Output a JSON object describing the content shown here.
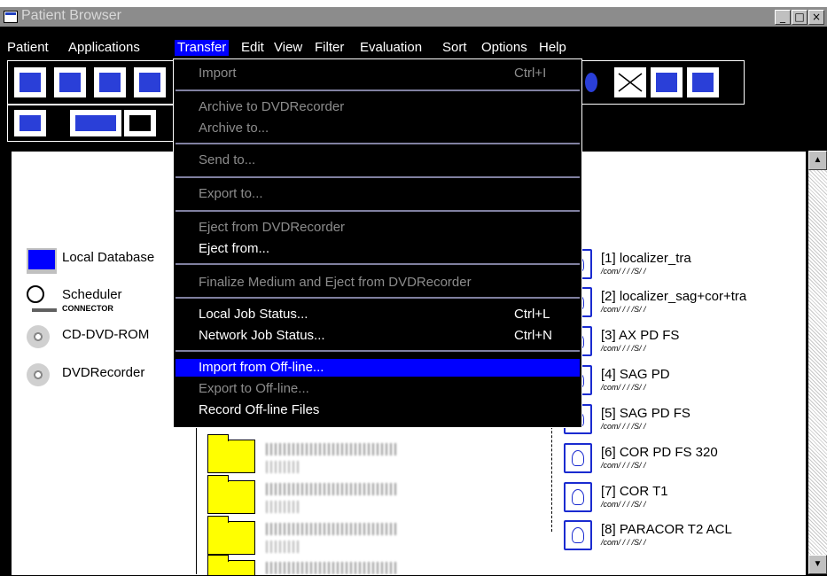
{
  "window": {
    "title": "Patient Browser",
    "controls": [
      "_",
      "□",
      "×"
    ]
  },
  "menubar": {
    "items": [
      {
        "label": "Patient",
        "key": "P"
      },
      {
        "label": "Applications",
        "key": "A"
      },
      {
        "label": "Transfer",
        "key": "T"
      },
      {
        "label": "Edit",
        "key": "E"
      },
      {
        "label": "View",
        "key": "V"
      },
      {
        "label": "Filter",
        "key": "F"
      },
      {
        "label": "Evaluation",
        "key": "l"
      },
      {
        "label": "Sort",
        "key": "r"
      },
      {
        "label": "Options",
        "key": "O"
      },
      {
        "label": "Help",
        "key": "H"
      }
    ]
  },
  "transfer_menu": {
    "items": [
      {
        "label": "Import",
        "shortcut": "Ctrl+I",
        "enabled": false
      },
      {
        "label": "Archive to DVDRecorder",
        "shortcut": "",
        "enabled": false
      },
      {
        "label": "Archive to...",
        "shortcut": "",
        "enabled": false
      },
      {
        "label": "Send to...",
        "shortcut": "",
        "enabled": false
      },
      {
        "label": "Export to...",
        "shortcut": "",
        "enabled": false
      },
      {
        "label": "Eject from DVDRecorder",
        "shortcut": "",
        "enabled": false
      },
      {
        "label": "Eject from...",
        "shortcut": "",
        "enabled": true
      },
      {
        "label": "Finalize Medium and Eject from DVDRecorder",
        "shortcut": "",
        "enabled": false
      },
      {
        "label": "Local Job Status...",
        "shortcut": "Ctrl+L",
        "enabled": true
      },
      {
        "label": "Network Job Status...",
        "shortcut": "Ctrl+N",
        "enabled": true
      },
      {
        "label": "Import from Off-line...",
        "shortcut": "",
        "enabled": true,
        "highlighted": true
      },
      {
        "label": "Export to Off-line...",
        "shortcut": "",
        "enabled": false
      },
      {
        "label": "Record Off-line Files",
        "shortcut": "",
        "enabled": true
      }
    ]
  },
  "devices": [
    {
      "label": "Local Database",
      "icon": "database-monitor-icon"
    },
    {
      "label": "Scheduler",
      "sublabel": "CONNECTOR",
      "icon": "clock-icon"
    },
    {
      "label": "CD-DVD-ROM",
      "icon": "disc-icon"
    },
    {
      "label": "DVDRecorder",
      "icon": "disc-icon"
    }
  ],
  "series": [
    {
      "name": "[1] localizer_tra",
      "path": "/com/ / / /S/  /"
    },
    {
      "name": "[2] localizer_sag+cor+tra",
      "path": "/com/ / / /S/  /"
    },
    {
      "name": "[3] AX PD FS",
      "path": "/com/ / / /S/  /"
    },
    {
      "name": "[4] SAG PD",
      "path": "/com/ / / /S/  /"
    },
    {
      "name": "[5] SAG PD FS",
      "path": "/com/ / / /S/  /"
    },
    {
      "name": "[6] COR PD FS 320",
      "path": "/com/ / / /S/  /"
    },
    {
      "name": "[7] COR T1",
      "path": "/com/ / / /S/  /"
    },
    {
      "name": "[8] PARACOR T2 ACL",
      "path": "/com/ / / /S/  /"
    }
  ],
  "colors": {
    "menu_bg": "#000000",
    "highlight": "#0000ff",
    "disabled": "#8c8c8c",
    "folder": "#ffff00"
  }
}
